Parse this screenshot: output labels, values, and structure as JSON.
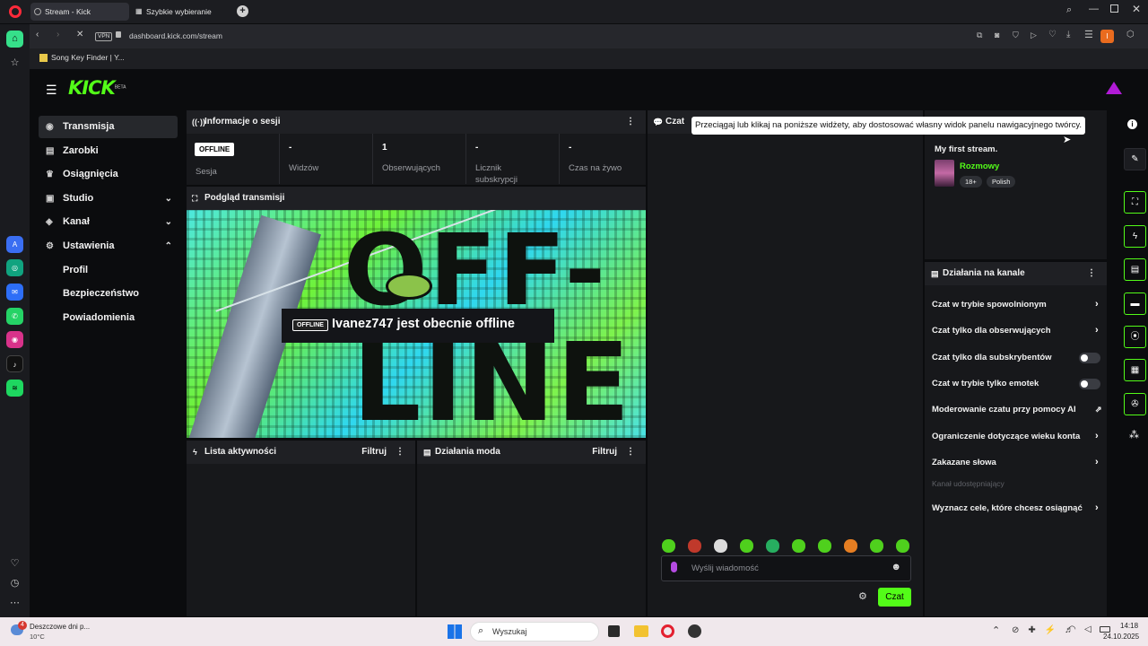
{
  "browser": {
    "tabs": [
      "Stream - Kick Dashboard",
      "Szybkie wybieranie"
    ],
    "new_tab": "+",
    "url": "dashboard.kick.com/stream",
    "vpn": "VPN",
    "bookmark": "Song Key Finder | Y...",
    "ext_badge": "I"
  },
  "app": {
    "logo": "KICK",
    "logo_tag": "BETA",
    "accent": "#53fc18"
  },
  "nav": {
    "items": [
      {
        "label": "Transmisja",
        "icon": "stream-icon"
      },
      {
        "label": "Zarobki",
        "icon": "wallet-icon"
      },
      {
        "label": "Osiągnięcia",
        "icon": "trophy-icon"
      },
      {
        "label": "Studio",
        "icon": "studio-icon"
      },
      {
        "label": "Kanał",
        "icon": "channel-icon"
      },
      {
        "label": "Ustawienia",
        "icon": "gear-icon"
      }
    ],
    "sub": [
      "Profil",
      "Bezpieczeństwo",
      "Powiadomienia"
    ]
  },
  "session": {
    "title": "Informacje o sesji",
    "badge": "OFFLINE",
    "stats": [
      {
        "value": "",
        "label": "Sesja"
      },
      {
        "value": "-",
        "label": "Widzów"
      },
      {
        "value": "1",
        "label": "Obserwujących"
      },
      {
        "value": "-",
        "label": "Licznik subskrypcji"
      },
      {
        "value": "-",
        "label": "Czas na żywo"
      }
    ]
  },
  "preview": {
    "title": "Podgląd transmisji",
    "badge": "OFFLINE",
    "message": "Ivanez747 jest obecnie offline",
    "art_text": [
      "OFF-",
      "LINE"
    ]
  },
  "activity": {
    "title": "Lista aktywności",
    "filter": "Filtruj"
  },
  "modactions": {
    "title": "Działania moda",
    "filter": "Filtruj"
  },
  "chat": {
    "title": "Czat",
    "placeholder": "Wyślij wiadomość",
    "send": "Czat"
  },
  "tooltip": "Przeciągaj lub klikaj na poniższe widżety, aby dostosować własny widok panelu nawigacyjnego twórcy.",
  "stream_info": {
    "title": "My first stream.",
    "category": "Rozmowy",
    "tags": [
      "18+",
      "Polish"
    ]
  },
  "channel_actions": {
    "title": "Działania na kanale",
    "options": [
      {
        "label": "Czat w trybie spowolnionym",
        "type": "arrow"
      },
      {
        "label": "Czat tylko dla obserwujących",
        "type": "arrow"
      },
      {
        "label": "Czat tylko dla subskrybentów",
        "type": "toggle"
      },
      {
        "label": "Czat w trybie tylko emotek",
        "type": "toggle"
      },
      {
        "label": "Moderowanie czatu przy pomocy AI",
        "type": "external"
      },
      {
        "label": "Ograniczenie dotyczące wieku konta",
        "type": "arrow"
      },
      {
        "label": "Zakazane słowa",
        "type": "arrow"
      }
    ],
    "shared_heading": "Kanał udostępniający",
    "goal": "Wyznacz cele, które chcesz osiągnąć"
  },
  "taskbar": {
    "weather_title": "Deszczowe dni p...",
    "weather_temp": "10°C",
    "weather_badge": "4",
    "search": "Wyszukaj",
    "time": "14:18",
    "date": "24.10.2025"
  }
}
